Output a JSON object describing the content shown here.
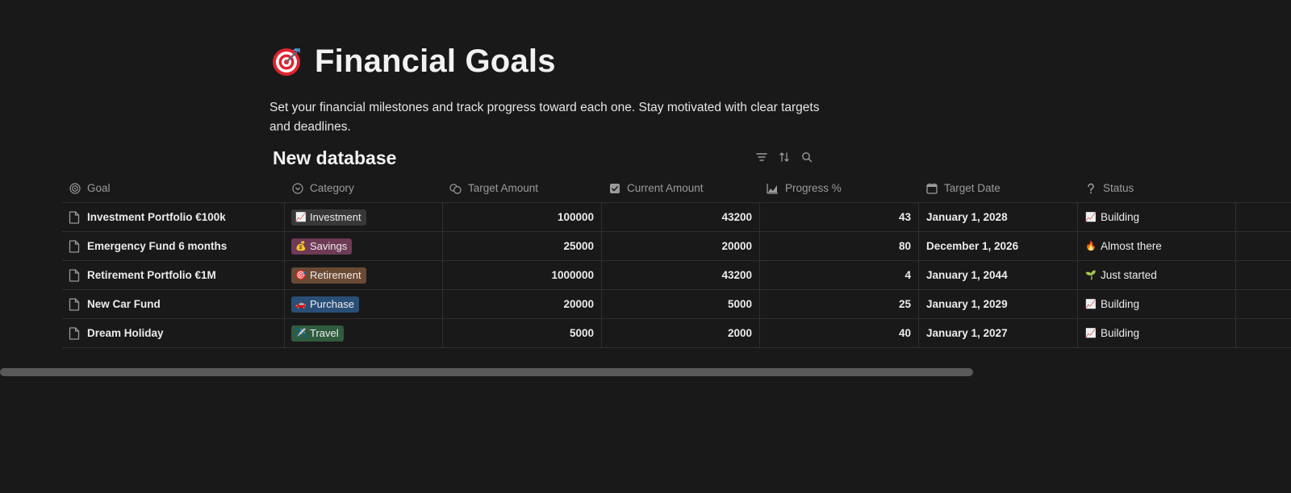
{
  "page": {
    "title": "Financial Goals",
    "title_icon": "direct-hit-icon",
    "description": "Set your financial milestones and track progress toward each one. Stay motivated with clear targets and deadlines."
  },
  "database": {
    "title": "New database",
    "tools": [
      "filter-icon",
      "sort-icon",
      "search-icon"
    ],
    "columns": [
      {
        "label": "Goal",
        "icon": "target-icon"
      },
      {
        "label": "Category",
        "icon": "select-icon"
      },
      {
        "label": "Target Amount",
        "icon": "coins-icon"
      },
      {
        "label": "Current Amount",
        "icon": "checkbox-icon"
      },
      {
        "label": "Progress %",
        "icon": "chart-icon"
      },
      {
        "label": "Target Date",
        "icon": "calendar-icon"
      },
      {
        "label": "Status",
        "icon": "question-icon"
      }
    ],
    "rows": [
      {
        "goal": "Investment Portfolio €100k",
        "category": {
          "emoji": "📈",
          "label": "Investment",
          "color": "#373737"
        },
        "target_amount": "100000",
        "current_amount": "43200",
        "progress": "43",
        "target_date": "January 1, 2028",
        "status": {
          "emoji": "📈",
          "label": "Building"
        }
      },
      {
        "goal": "Emergency Fund 6 months",
        "category": {
          "emoji": "💰",
          "label": "Savings",
          "color": "#6e3b56"
        },
        "target_amount": "25000",
        "current_amount": "20000",
        "progress": "80",
        "target_date": "December 1, 2026",
        "status": {
          "emoji": "🔥",
          "label": "Almost there"
        }
      },
      {
        "goal": "Retirement Portfolio €1M",
        "category": {
          "emoji": "🎯",
          "label": "Retirement",
          "color": "#6b4a34"
        },
        "target_amount": "1000000",
        "current_amount": "43200",
        "progress": "4",
        "target_date": "January 1, 2044",
        "status": {
          "emoji": "🌱",
          "label": "Just started"
        }
      },
      {
        "goal": "New Car Fund",
        "category": {
          "emoji": "🚗",
          "label": "Purchase",
          "color": "#2a4f77"
        },
        "target_amount": "20000",
        "current_amount": "5000",
        "progress": "25",
        "target_date": "January 1, 2029",
        "status": {
          "emoji": "📈",
          "label": "Building"
        }
      },
      {
        "goal": "Dream Holiday",
        "category": {
          "emoji": "✈️",
          "label": "Travel",
          "color": "#2f5b3f"
        },
        "target_amount": "5000",
        "current_amount": "2000",
        "progress": "40",
        "target_date": "January 1, 2027",
        "status": {
          "emoji": "📈",
          "label": "Building"
        }
      }
    ]
  },
  "colors": {
    "background": "#191919",
    "border": "#2f2f2f",
    "header_text": "#9b9b9b",
    "scrollbar": "#5a5a5a"
  }
}
